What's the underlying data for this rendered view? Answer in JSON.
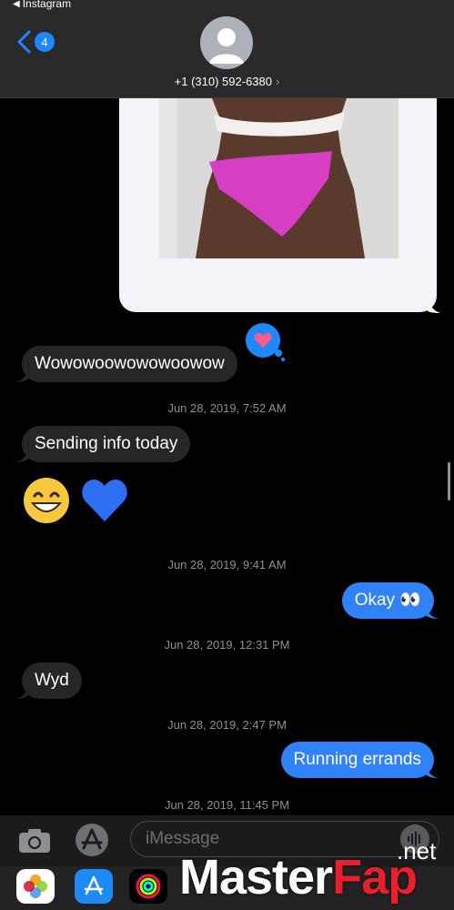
{
  "status_bar": {
    "back_app": "Instagram"
  },
  "header": {
    "back_count": "4",
    "contact": "+1 (310) 592-6380",
    "chevron": "›"
  },
  "reaction": {
    "icon": "heart-icon",
    "color": "#1e88ff"
  },
  "messages": [
    {
      "text": "Wowowoowowowoowow",
      "direction": "incoming"
    },
    {
      "timestamp": "Jun 28, 2019, 7:52 AM"
    },
    {
      "text": "Sending info today",
      "direction": "incoming"
    },
    {
      "text": "😁 💙",
      "direction": "incoming",
      "emoji_only": true
    },
    {
      "timestamp": "Jun 28, 2019, 9:41 AM"
    },
    {
      "text": "Okay 👀",
      "direction": "outgoing"
    },
    {
      "timestamp": "Jun 28, 2019, 12:31 PM"
    },
    {
      "text": "Wyd",
      "direction": "incoming"
    },
    {
      "timestamp": "Jun 28, 2019, 2:47 PM"
    },
    {
      "text": "Running errands",
      "direction": "outgoing"
    },
    {
      "timestamp": "Jun 28, 2019, 11:45 PM"
    }
  ],
  "input": {
    "placeholder": "iMessage"
  },
  "app_drawer": [
    "photos-icon",
    "app-store-icon",
    "activity-icon"
  ],
  "watermark": {
    "master": "Master",
    "fap": "Fap",
    "net": ".net"
  },
  "colors": {
    "outgoing": "#2f82f7",
    "incoming": "#262628",
    "background": "#000000"
  }
}
